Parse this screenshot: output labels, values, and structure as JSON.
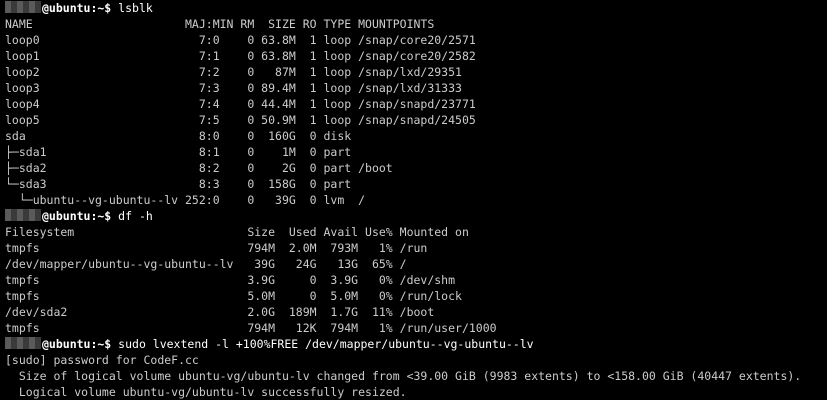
{
  "colors": {
    "background": "#000000",
    "text": "#cccccc",
    "prompt": "#ffffff",
    "redacted": "#4a4a4a"
  },
  "lines": [
    {
      "kind": "prompt",
      "host": "@ubuntu:~$",
      "cmd": " lsblk"
    },
    {
      "kind": "output",
      "text": "NAME                      MAJ:MIN RM  SIZE RO TYPE MOUNTPOINTS"
    },
    {
      "kind": "output",
      "text": "loop0                       7:0    0 63.8M  1 loop /snap/core20/2571"
    },
    {
      "kind": "output",
      "text": "loop1                       7:1    0 63.8M  1 loop /snap/core20/2582"
    },
    {
      "kind": "output",
      "text": "loop2                       7:2    0   87M  1 loop /snap/lxd/29351"
    },
    {
      "kind": "output",
      "text": "loop3                       7:3    0 89.4M  1 loop /snap/lxd/31333"
    },
    {
      "kind": "output",
      "text": "loop4                       7:4    0 44.4M  1 loop /snap/snapd/23771"
    },
    {
      "kind": "output",
      "text": "loop5                       7:5    0 50.9M  1 loop /snap/snapd/24505"
    },
    {
      "kind": "output",
      "text": "sda                         8:0    0  160G  0 disk"
    },
    {
      "kind": "output",
      "text": "├─sda1                      8:1    0    1M  0 part"
    },
    {
      "kind": "output",
      "text": "├─sda2                      8:2    0    2G  0 part /boot"
    },
    {
      "kind": "output",
      "text": "└─sda3                      8:3    0  158G  0 part"
    },
    {
      "kind": "output",
      "text": "  └─ubuntu--vg-ubuntu--lv 252:0    0   39G  0 lvm  /"
    },
    {
      "kind": "prompt",
      "host": "@ubuntu:~$",
      "cmd": " df -h"
    },
    {
      "kind": "output",
      "text": "Filesystem                         Size  Used Avail Use% Mounted on"
    },
    {
      "kind": "output",
      "text": "tmpfs                              794M  2.0M  793M   1% /run"
    },
    {
      "kind": "output",
      "text": "/dev/mapper/ubuntu--vg-ubuntu--lv   39G   24G   13G  65% /"
    },
    {
      "kind": "output",
      "text": "tmpfs                              3.9G     0  3.9G   0% /dev/shm"
    },
    {
      "kind": "output",
      "text": "tmpfs                              5.0M     0  5.0M   0% /run/lock"
    },
    {
      "kind": "output",
      "text": "/dev/sda2                          2.0G  189M  1.7G  11% /boot"
    },
    {
      "kind": "output",
      "text": "tmpfs                              794M   12K  794M   1% /run/user/1000"
    },
    {
      "kind": "prompt",
      "host": "@ubuntu:~$",
      "cmd": " sudo lvextend -l +100%FREE /dev/mapper/ubuntu--vg-ubuntu--lv"
    },
    {
      "kind": "output",
      "text": "[sudo] password for CodeF.cc"
    },
    {
      "kind": "output",
      "text": "  Size of logical volume ubuntu-vg/ubuntu-lv changed from <39.00 GiB (9983 extents) to <158.00 GiB (40447 extents)."
    },
    {
      "kind": "output",
      "text": "  Logical volume ubuntu-vg/ubuntu-lv successfully resized."
    }
  ]
}
